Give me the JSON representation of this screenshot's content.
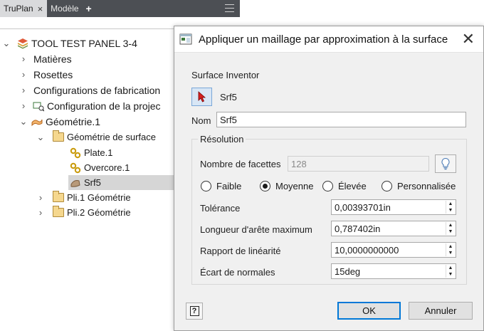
{
  "browser": {
    "tabs": [
      {
        "label": "TruPlan",
        "active": true
      },
      {
        "label": "Modèle",
        "active": false
      }
    ],
    "tab_close": "×",
    "add_tab": "+",
    "tree": [
      {
        "label": "TOOL TEST PANEL 3-4",
        "icon": "part-stack-icon",
        "expanded": true
      },
      {
        "label": "Matières",
        "icon": "none",
        "expanded": false
      },
      {
        "label": "Rosettes",
        "icon": "none",
        "expanded": false
      },
      {
        "label": "Configurations de fabrication",
        "icon": "none",
        "expanded": false
      },
      {
        "label": "Configuration de la projec",
        "icon": "projection-icon",
        "expanded": false
      },
      {
        "label": "Géométrie.1",
        "icon": "geometry-icon",
        "expanded": true
      },
      {
        "label": "Géométrie de surface",
        "icon": "folder-icon",
        "expanded": true
      },
      {
        "label": "Plate.1",
        "icon": "link-icon"
      },
      {
        "label": "Overcore.1",
        "icon": "link-icon"
      },
      {
        "label": "Srf5",
        "icon": "surface-mesh-icon",
        "selected": true
      },
      {
        "label": "Pli.1 Géométrie",
        "icon": "folder-icon",
        "expanded": false
      },
      {
        "label": "Pli.2 Géométrie",
        "icon": "folder-icon",
        "expanded": false
      }
    ]
  },
  "dialog": {
    "title": "Appliquer un maillage par approximation à la surface",
    "close_glyph": "✕",
    "surface_label": "Surface Inventor",
    "surface_value": "Srf5",
    "name_label": "Nom",
    "name_value": "Srf5",
    "resolution": {
      "title": "Résolution",
      "facets_label": "Nombre de facettes",
      "facets_value": "128",
      "options": [
        {
          "label": "Faible",
          "checked": false
        },
        {
          "label": "Moyenne",
          "checked": true
        },
        {
          "label": "Élevée",
          "checked": false
        },
        {
          "label": "Personnalisée",
          "checked": false
        }
      ],
      "tolerance_label": "Tolérance",
      "tolerance_value": "0,00393701in",
      "edge_length_label": "Longueur d'arête maximum",
      "edge_length_value": "0,787402in",
      "aspect_ratio_label": "Rapport de linéarité",
      "aspect_ratio_value": "10,0000000000",
      "normal_dev_label": "Écart de normales",
      "normal_dev_value": "15deg"
    },
    "help_glyph": "?",
    "ok_label": "OK",
    "cancel_label": "Annuler"
  }
}
